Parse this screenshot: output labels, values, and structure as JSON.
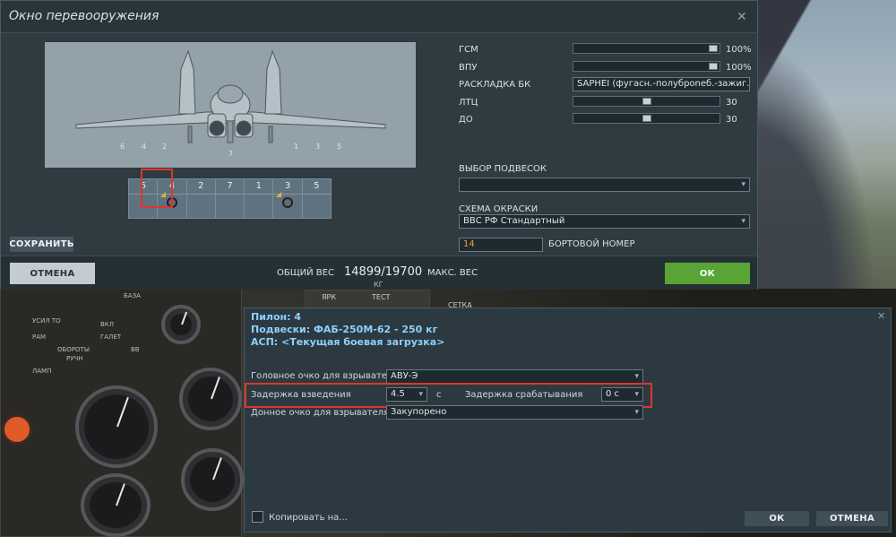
{
  "rearm": {
    "title": "Окно перевооружения",
    "pylon_numbers_view": [
      "6",
      "4",
      "2",
      "7",
      "1",
      "3",
      "5"
    ],
    "pylon_numbers_strip": [
      "6",
      "4",
      "2",
      "7",
      "1",
      "3",
      "5"
    ],
    "save_label": "СОХРАНИТЬ",
    "cancel_label": "ОТМЕНА",
    "ok_label": "ОК",
    "weight": {
      "total_label": "ОБЩИЙ ВЕС",
      "current": "14899",
      "separator": "/",
      "max": "19700",
      "unit": "КГ",
      "max_label": "МАКС. ВЕС"
    },
    "resources": [
      {
        "label": "ГСМ",
        "value": "100%",
        "level": 1.0
      },
      {
        "label": "ВПУ",
        "value": "100%",
        "level": 1.0
      },
      {
        "label": "ЛТЦ",
        "value": "30",
        "level": 0.5
      },
      {
        "label": "ДО",
        "value": "30",
        "level": 0.5
      }
    ],
    "ammo_label": "РАСКЛАДКА БК",
    "ammo_value": "SAPHEI (фугасн.-полуброneб.-зажиг.)",
    "loadout_label": "ВЫБОР ПОДВЕСОК",
    "loadout_value": "",
    "livery_label": "СХЕМА ОКРАСКИ",
    "livery_value": "ВВС РФ Стандартный",
    "board_number": "14",
    "board_label": "БОРТОВОЙ НОМЕР"
  },
  "detail": {
    "pylon": "Пилон: 4",
    "store": "Подвески: ФАБ-250М-62 - 250 кг",
    "asp": "АСП: <Текущая боевая загрузка>",
    "nose_fuze_label": "Головное очко для взрывателя",
    "nose_fuze_value": "АВУ-Э",
    "arm_delay_label": "Задержка взведения",
    "arm_delay_value": "4.5",
    "arm_delay_unit": "с",
    "func_delay_label": "Задержка срабатывания",
    "func_delay_value": "0 с",
    "tail_fuze_label": "Донное очко для взрывателя",
    "tail_fuze_value": "Закупорено",
    "copy_label": "Копировать на...",
    "ok_label": "ОК",
    "cancel_label": "ОТМЕНА"
  },
  "cockpit_text": [
    "ЯРК",
    "ТЕСТ",
    "СЕТКА",
    "БАЗА",
    "УСИЛ ТО",
    "ОБОРОТЫ",
    "РУЧН",
    "ВКЛ",
    "ГАЛЕТ",
    "РАМ",
    "ЛАМП",
    "ВВ"
  ]
}
